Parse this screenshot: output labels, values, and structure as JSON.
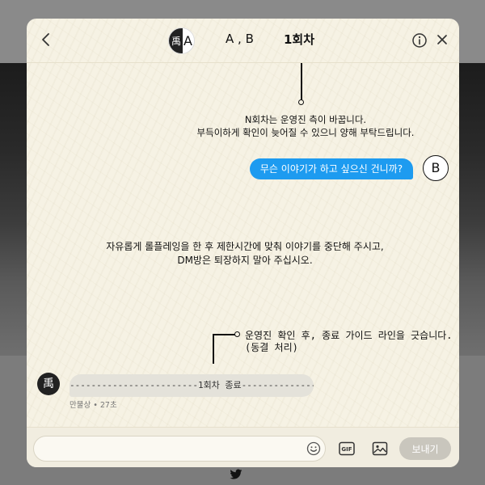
{
  "header": {
    "avatar_letter": "A",
    "avatar_glyph": "禹",
    "participants": "A , B",
    "round_title": "1회차"
  },
  "notice": {
    "line1": "N회차는 운영진 측이 바꿉니다.",
    "line2": "부득이하게 확인이 늦어질 수 있으니 양해 부탁드립니다."
  },
  "outgoing_message": {
    "text": "무슨 이야기가 하고 싶으신 건니까?",
    "avatar_letter": "B"
  },
  "rule": {
    "line1": "자유롭게 롤플레잉을 한 후 제한시간에 맞춰 이야기를 중단해 주시고,",
    "line2": "DM방은 퇴장하지 말아 주십시오."
  },
  "end_note": {
    "line1": "운영진 확인 후, 종료 가이드 라인을 긋습니다.",
    "line2": "(동결 처리)"
  },
  "incoming_message": {
    "text": "------------------------1회차 종료--------------------",
    "sender_glyph": "禹",
    "meta": "만물상 • 27초"
  },
  "composer": {
    "input_value": "",
    "input_placeholder": "",
    "gif_label": "GIF",
    "send_label": "보내기"
  },
  "colors": {
    "accent": "#1d9bf0",
    "modal_bg": "#f6f2e4",
    "send_disabled": "#c9c6bd"
  }
}
